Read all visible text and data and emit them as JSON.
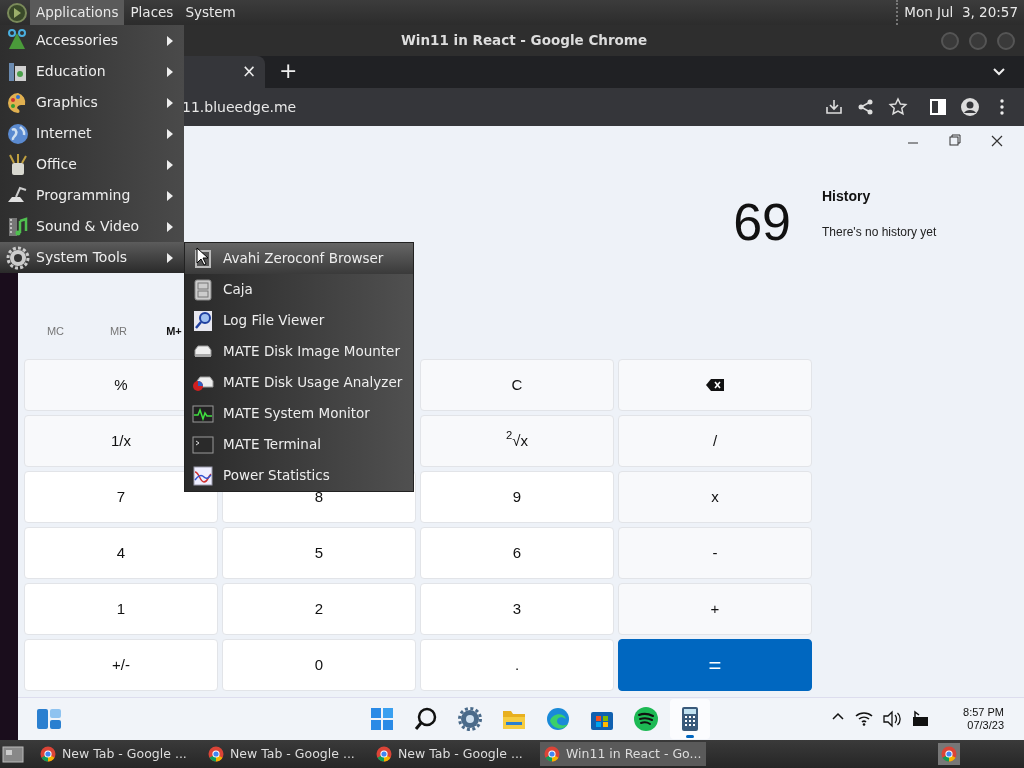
{
  "top_panel": {
    "menus": [
      {
        "label": "Applications",
        "selected": true
      },
      {
        "label": "Places",
        "selected": false
      },
      {
        "label": "System",
        "selected": false
      }
    ],
    "clock": "Mon Jul  3, 20:57"
  },
  "browser": {
    "title": "Win11 in React - Google Chrome",
    "tab_close": "×",
    "new_tab": "+",
    "address": "11.blueedge.me"
  },
  "calculator": {
    "display": "69",
    "memory": [
      "MC",
      "MR",
      "M+"
    ],
    "rows": [
      [
        {
          "kind": "function",
          "label": "%"
        },
        null,
        {
          "kind": "function",
          "label": "C"
        },
        {
          "kind": "backspace"
        }
      ],
      [
        {
          "kind": "function",
          "label": "1/x"
        },
        null,
        {
          "kind": "function",
          "label": "$^{2}$√x"
        },
        {
          "kind": "function",
          "label": "/"
        }
      ],
      [
        {
          "kind": "digit",
          "label": "7"
        },
        {
          "kind": "digit",
          "label": "8"
        },
        {
          "kind": "digit",
          "label": "9"
        },
        {
          "kind": "function",
          "label": "x"
        }
      ],
      [
        {
          "kind": "digit",
          "label": "4"
        },
        {
          "kind": "digit",
          "label": "5"
        },
        {
          "kind": "digit",
          "label": "6"
        },
        {
          "kind": "function",
          "label": "-"
        }
      ],
      [
        {
          "kind": "digit",
          "label": "1"
        },
        {
          "kind": "digit",
          "label": "2"
        },
        {
          "kind": "digit",
          "label": "3"
        },
        {
          "kind": "function",
          "label": "+"
        }
      ],
      [
        {
          "kind": "digit",
          "label": "+/-"
        },
        {
          "kind": "digit",
          "label": "0"
        },
        {
          "kind": "digit",
          "label": "."
        },
        {
          "kind": "equals",
          "label": "="
        }
      ]
    ],
    "history": {
      "title": "History",
      "empty_text": "There's no history yet"
    }
  },
  "taskbar": {
    "apps": [
      {
        "selected": false
      },
      {
        "selected": false
      },
      {
        "selected": false
      },
      {
        "selected": false
      },
      {
        "selected": false
      },
      {
        "selected": false
      },
      {
        "selected": false
      },
      {
        "selected": true
      }
    ],
    "time": "8:57 PM",
    "date": "07/3/23"
  },
  "applications_menu": [
    {
      "label": "Accessories",
      "selected": false
    },
    {
      "label": "Education",
      "selected": false
    },
    {
      "label": "Graphics",
      "selected": false
    },
    {
      "label": "Internet",
      "selected": false
    },
    {
      "label": "Office",
      "selected": false
    },
    {
      "label": "Programming",
      "selected": false
    },
    {
      "label": "Sound & Video",
      "selected": false
    },
    {
      "label": "System Tools",
      "selected": true
    }
  ],
  "system_tools_menu": [
    {
      "label": "Avahi Zeroconf Browser",
      "selected": true
    },
    {
      "label": "Caja",
      "selected": false
    },
    {
      "label": "Log File Viewer",
      "selected": false
    },
    {
      "label": "MATE Disk Image Mounter",
      "selected": false
    },
    {
      "label": "MATE Disk Usage Analyzer",
      "selected": false
    },
    {
      "label": "MATE System Monitor",
      "selected": false
    },
    {
      "label": "MATE Terminal",
      "selected": false
    },
    {
      "label": "Power Statistics",
      "selected": false
    }
  ],
  "bottom_panel": {
    "tasks": [
      {
        "label": "New Tab - Google ...",
        "selected": false
      },
      {
        "label": "New Tab - Google ...",
        "selected": false
      },
      {
        "label": "New Tab - Google ...",
        "selected": false
      },
      {
        "label": "Win11 in React - Go...",
        "selected": true
      }
    ]
  }
}
